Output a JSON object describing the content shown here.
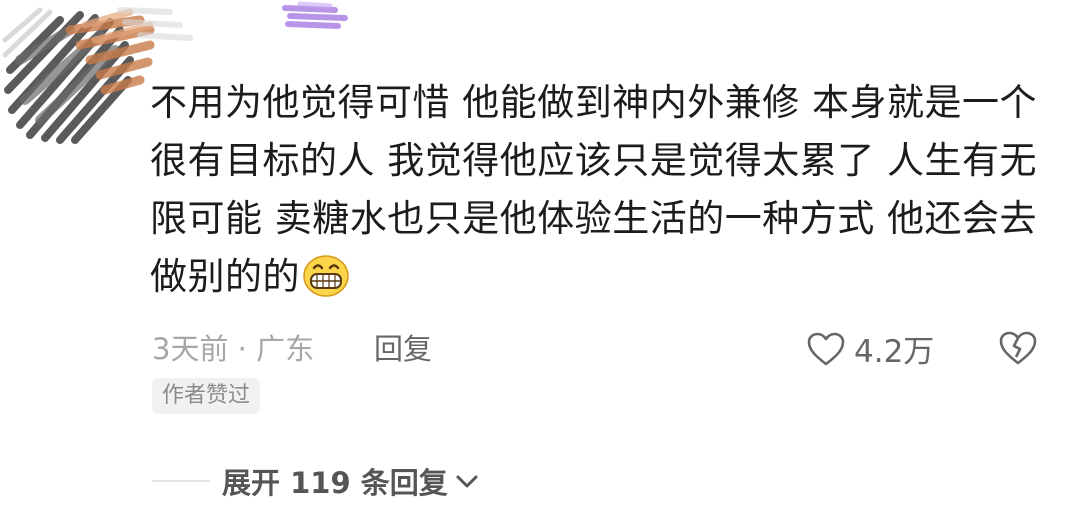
{
  "comment": {
    "lines": [
      "不用为他觉得可惜 他能做到神内外兼修 本身就是一个",
      "很有目标的人 我觉得他应该只是觉得太累了 人生有无",
      "限可能 卖糖水也只是他体验生活的一种方式 他还会去",
      "做别的的"
    ],
    "emoji": "grinning-face-icon"
  },
  "meta": {
    "time_location": "3天前 · 广东",
    "reply_label": "回复"
  },
  "likes": {
    "count": "4.2万",
    "icon": "heart-outline-icon"
  },
  "dislike": {
    "icon": "broken-heart-icon"
  },
  "badge": {
    "label": "作者赞过"
  },
  "expand": {
    "label": "展开 119 条回复",
    "icon": "chevron-down-icon"
  },
  "avatar": {
    "icon": "scribbled-avatar-icon"
  },
  "colors": {
    "text": "#1c1c1c",
    "meta": "#a7a7a7",
    "secondary": "#666666",
    "badge_bg": "#f1f1f1"
  }
}
